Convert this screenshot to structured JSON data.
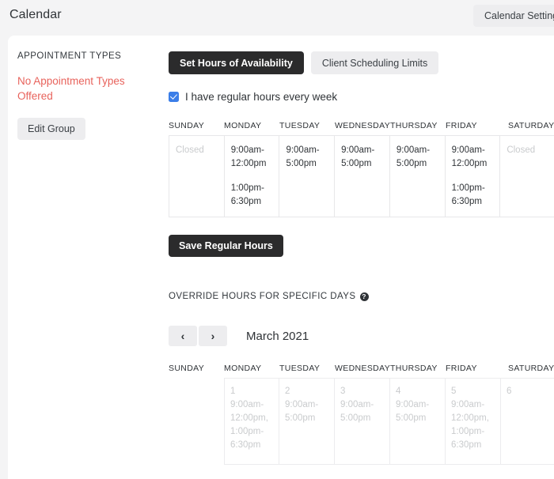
{
  "topbar": {
    "title": "Calendar",
    "settings_button": "Calendar Settings"
  },
  "sidebar": {
    "heading": "APPOINTMENT TYPES",
    "empty_message": "No Appointment Types Offered",
    "empty_color": "#e8635c",
    "edit_group_button": "Edit Group"
  },
  "tabs": [
    {
      "label": "Set Hours of Availability",
      "active": true
    },
    {
      "label": "Client Scheduling Limits",
      "active": false
    }
  ],
  "regular_hours": {
    "checkbox_label": "I have regular hours every week",
    "checkbox_checked": true,
    "checkbox_color": "#3b7ee8",
    "day_headers": [
      "SUNDAY",
      "MONDAY",
      "TUESDAY",
      "WEDNESDAY",
      "THURSDAY",
      "FRIDAY",
      "SATURDAY"
    ],
    "cells": [
      {
        "closed": true,
        "line1": "Closed",
        "line2": ""
      },
      {
        "closed": false,
        "line1": "9:00am-12:00pm",
        "line2": "1:00pm-6:30pm"
      },
      {
        "closed": false,
        "line1": "9:00am-5:00pm",
        "line2": ""
      },
      {
        "closed": false,
        "line1": "9:00am-5:00pm",
        "line2": ""
      },
      {
        "closed": false,
        "line1": "9:00am-5:00pm",
        "line2": ""
      },
      {
        "closed": false,
        "line1": "9:00am-12:00pm",
        "line2": "1:00pm-6:30pm"
      },
      {
        "closed": true,
        "line1": "Closed",
        "line2": ""
      }
    ],
    "save_button": "Save Regular Hours"
  },
  "override": {
    "title": "OVERRIDE HOURS FOR SPECIFIC DAYS",
    "help_icon": "?",
    "prev_label": "‹",
    "next_label": "›",
    "month_label": "March 2021",
    "day_headers": [
      "SUNDAY",
      "MONDAY",
      "TUESDAY",
      "WEDNESDAY",
      "THURSDAY",
      "FRIDAY",
      "SATURDAY"
    ],
    "week1": [
      {
        "empty": true,
        "day": "",
        "hours": ""
      },
      {
        "empty": false,
        "day": "1",
        "hours": "9:00am-12:00pm, 1:00pm-6:30pm"
      },
      {
        "empty": false,
        "day": "2",
        "hours": "9:00am-5:00pm"
      },
      {
        "empty": false,
        "day": "3",
        "hours": "9:00am-5:00pm"
      },
      {
        "empty": false,
        "day": "4",
        "hours": "9:00am-5:00pm"
      },
      {
        "empty": false,
        "day": "5",
        "hours": "9:00am-12:00pm, 1:00pm-6:30pm"
      },
      {
        "empty": false,
        "day": "6",
        "hours": ""
      }
    ]
  }
}
